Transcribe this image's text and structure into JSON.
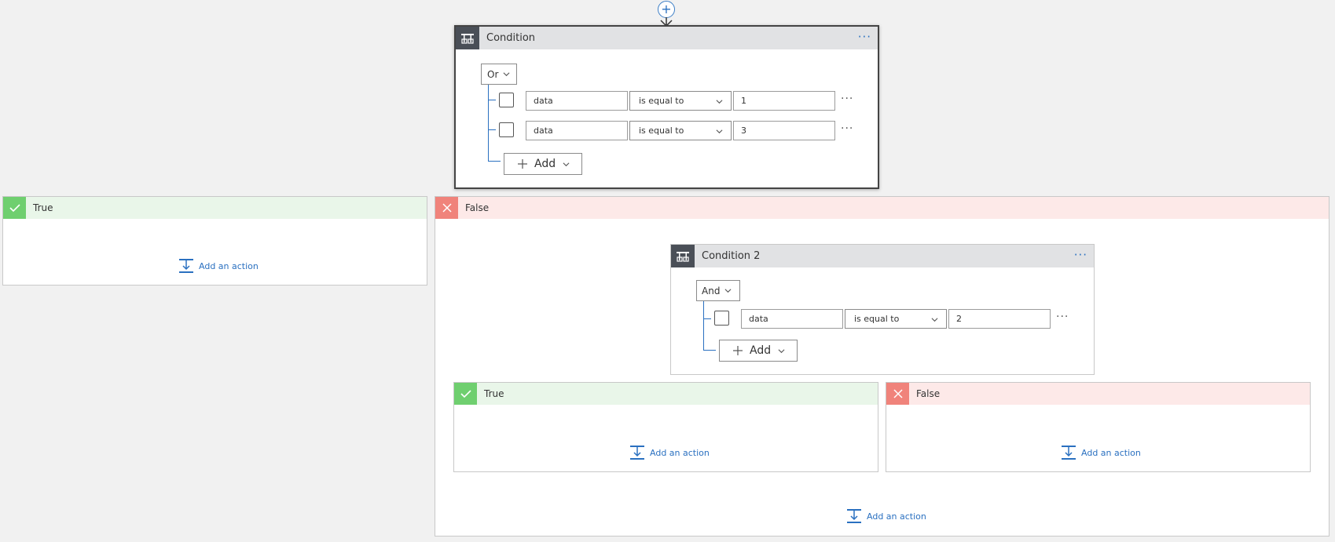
{
  "condition1": {
    "title": "Condition",
    "more": "···",
    "group_operator": "Or",
    "rows": [
      {
        "left": "data",
        "operator": "is equal to",
        "right": "1",
        "more": "···"
      },
      {
        "left": "data",
        "operator": "is equal to",
        "right": "3",
        "more": "···"
      }
    ],
    "add_label": "Add"
  },
  "branch_true": {
    "title": "True",
    "add_action": "Add an action"
  },
  "branch_false": {
    "title": "False",
    "add_action": "Add an action"
  },
  "condition2": {
    "title": "Condition 2",
    "more": "···",
    "group_operator": "And",
    "rows": [
      {
        "left": "data",
        "operator": "is equal to",
        "right": "2",
        "more": "···"
      }
    ],
    "add_label": "Add"
  },
  "nested_true": {
    "title": "True",
    "add_action": "Add an action"
  },
  "nested_false": {
    "title": "False",
    "add_action": "Add an action"
  },
  "icons": {
    "insert": "plus-circle-icon",
    "condition": "condition-icon",
    "check": "check-icon",
    "cross": "close-icon",
    "add_action": "add-action-icon"
  },
  "colors": {
    "accent": "#2a70c0",
    "true_header": "#e9f6e9",
    "true_icon": "#6fcf6f",
    "false_header": "#fde9e8",
    "false_icon": "#f0837b",
    "card_icon": "#4a4f57"
  }
}
